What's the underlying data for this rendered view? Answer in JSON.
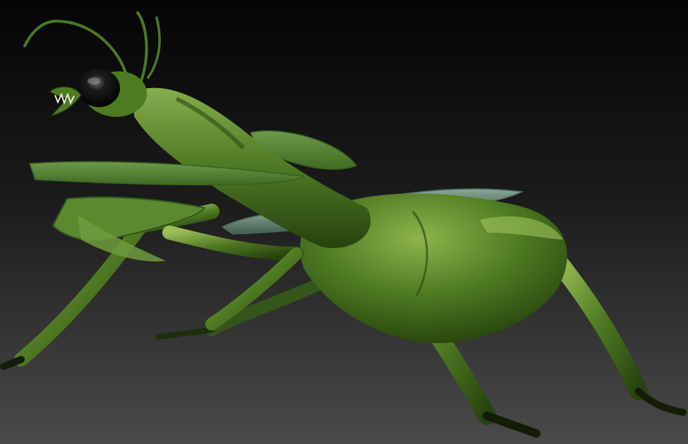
{
  "scene": {
    "subject": "mantis-3d-sculpt",
    "background_top": "#050505",
    "background_bottom": "#4a4a4a",
    "body_color": "#4f7a22",
    "body_highlight": "#9cc25a",
    "body_shadow": "#24400c",
    "wing_color": "#5a7a6a",
    "eye_color": "#0c0c0c",
    "claw_color": "#111a08"
  }
}
